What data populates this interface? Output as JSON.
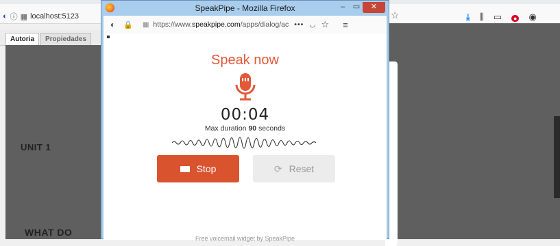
{
  "background": {
    "url_text": "localhost:5123",
    "tabs": [
      "Autoria",
      "Propiedades"
    ],
    "unit_heading": "UNIT 1",
    "section_heading": "WHAT DO",
    "icons": [
      "shield-icon",
      "info-icon",
      "page-icon",
      "star-icon",
      "download-icon",
      "library-icon",
      "sidebar-icon",
      "addon-icon",
      "extension-icon"
    ]
  },
  "popup": {
    "window_title": "SpeakPipe - Mozilla Firefox",
    "controls": {
      "minimize": "–",
      "maximize": "▭",
      "close": "✕"
    },
    "url_prefix": "https://www.",
    "url_domain": "speakpipe.com",
    "url_rest": "/apps/dialog/ac",
    "more_label": "•••",
    "heading": "Speak now",
    "timer": "00:04",
    "max_duration_prefix": "Max duration ",
    "max_duration_value": "90",
    "max_duration_suffix": " seconds",
    "stop_label": "Stop",
    "reset_label": "Reset",
    "footer": "Free voicemail widget by SpeakPipe",
    "colors": {
      "accent": "#d9532f",
      "heading": "#e2593a",
      "titlebar": "#a9cdec"
    }
  }
}
